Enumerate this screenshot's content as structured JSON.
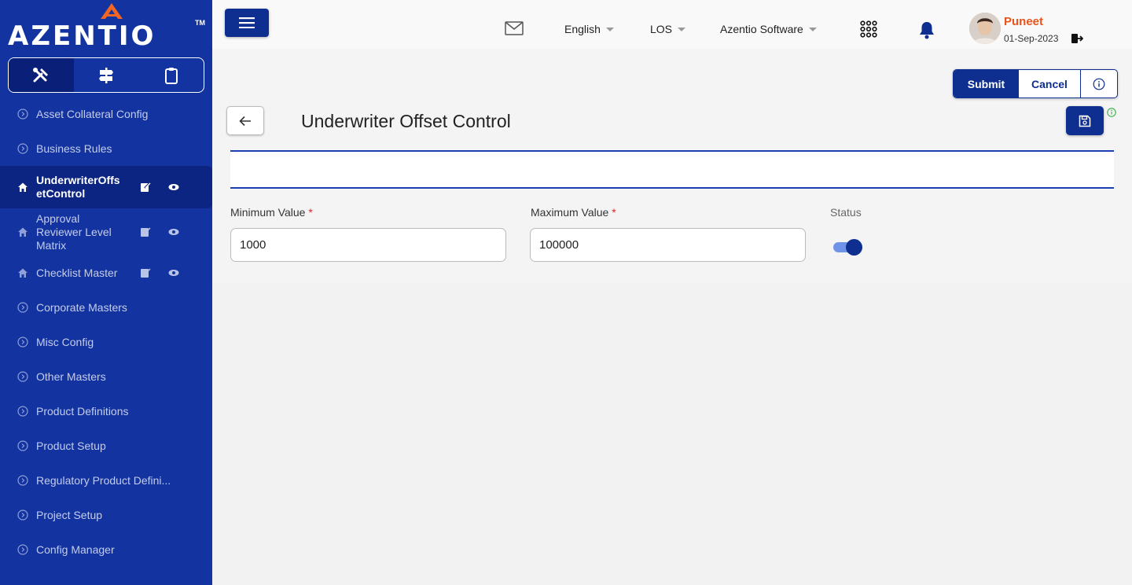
{
  "brand": {
    "name": "AZENTIO",
    "tm": "TM"
  },
  "sidebar": {
    "mode_tabs": [
      "tools",
      "signpost",
      "clipboard"
    ],
    "items": [
      {
        "label": "Asset Collateral Config",
        "icon": "chevron-circle-icon"
      },
      {
        "label": "Business Rules",
        "icon": "chevron-circle-icon"
      },
      {
        "label": "UnderwriterOffsetControl",
        "icon": "home-icon",
        "active": true
      },
      {
        "label": "Approval Reviewer Level Matrix",
        "icon": "home-icon"
      },
      {
        "label": "Checklist Master",
        "icon": "home-icon"
      },
      {
        "label": "Corporate Masters",
        "icon": "chevron-circle-icon"
      },
      {
        "label": "Misc Config",
        "icon": "chevron-circle-icon"
      },
      {
        "label": "Other Masters",
        "icon": "chevron-circle-icon"
      },
      {
        "label": "Product Definitions",
        "icon": "chevron-circle-icon"
      },
      {
        "label": "Product Setup",
        "icon": "chevron-circle-icon"
      },
      {
        "label": "Regulatory Product Defini...",
        "icon": "chevron-circle-icon"
      },
      {
        "label": "Project Setup",
        "icon": "chevron-circle-icon"
      },
      {
        "label": "Config Manager",
        "icon": "chevron-circle-icon"
      }
    ]
  },
  "header": {
    "language": "English",
    "module": "LOS",
    "company": "Azentio Software",
    "user": {
      "name": "Puneet",
      "date": "01-Sep-2023"
    }
  },
  "actions": {
    "submit": "Submit",
    "cancel": "Cancel"
  },
  "page": {
    "title": "Underwriter Offset Control",
    "fields": {
      "min_label": "Minimum Value",
      "min_value": "1000",
      "max_label": "Maximum Value",
      "max_value": "100000",
      "required_mark": "*",
      "status_label": "Status",
      "status_on": true
    }
  },
  "colors": {
    "sidebar": "#1233a0",
    "primary": "#0e2f8f",
    "accent": "#e8541c"
  }
}
